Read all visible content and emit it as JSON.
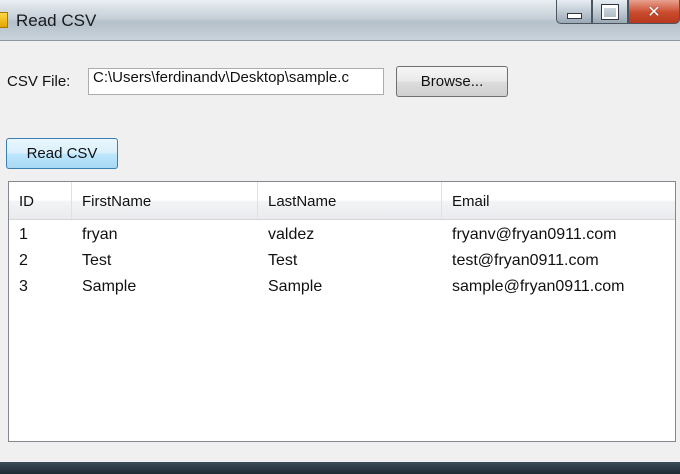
{
  "window": {
    "title": "Read CSV"
  },
  "form": {
    "csv_label": "CSV File:",
    "csv_path": "C:\\Users\\ferdinandv\\Desktop\\sample.c",
    "browse_label": "Browse...",
    "read_label": "Read CSV"
  },
  "grid": {
    "columns": [
      "ID",
      "FirstName",
      "LastName",
      "Email"
    ],
    "rows": [
      [
        "1",
        "fryan",
        "valdez",
        "fryanv@fryan0911.com"
      ],
      [
        "2",
        "Test",
        "Test",
        "test@fryan0911.com"
      ],
      [
        "3",
        "Sample",
        "Sample",
        "sample@fryan0911.com"
      ]
    ]
  },
  "icons": {
    "app": "csv-app-icon",
    "minimize": "minimize-icon",
    "maximize": "maximize-icon",
    "close": "close-icon"
  },
  "colors": {
    "close_button": "#c94a2c",
    "focused_button_border": "#3c7fb1"
  }
}
